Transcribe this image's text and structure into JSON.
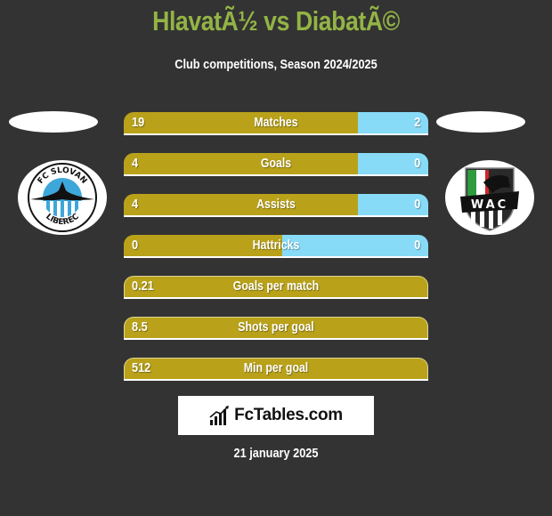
{
  "header": {
    "title": "HlavatÃ½ vs DiabatÃ©",
    "subtitle": "Club competitions, Season 2024/2025"
  },
  "teams": {
    "left": {
      "name": "FC Slovan Liberec",
      "logo_text_top": "FC SLOVAN",
      "logo_text_bottom": "LIBEREC",
      "icon": "fc-slovan-liberec-logo"
    },
    "right": {
      "name": "WAC",
      "logo_text": "WAC",
      "icon": "wac-logo"
    }
  },
  "colors": {
    "left_bar": "#B9A21A",
    "right_bar": "#87DBF7",
    "title": "#93B445",
    "background": "#333333"
  },
  "stats": [
    {
      "label": "Matches",
      "left": "19",
      "right": "2",
      "left_share": 0.77
    },
    {
      "label": "Goals",
      "left": "4",
      "right": "0",
      "left_share": 0.77
    },
    {
      "label": "Assists",
      "left": "4",
      "right": "0",
      "left_share": 0.77
    },
    {
      "label": "Hattricks",
      "left": "0",
      "right": "0",
      "left_share": 0.52
    },
    {
      "label": "Goals per match",
      "left": "0.21",
      "right": null,
      "left_share": 1
    },
    {
      "label": "Shots per goal",
      "left": "8.5",
      "right": null,
      "left_share": 1
    },
    {
      "label": "Min per goal",
      "left": "512",
      "right": null,
      "left_share": 1
    }
  ],
  "brand": {
    "name": "FcTables.com",
    "icon": "bar-chart-icon"
  },
  "footer": {
    "date": "21 january 2025"
  }
}
